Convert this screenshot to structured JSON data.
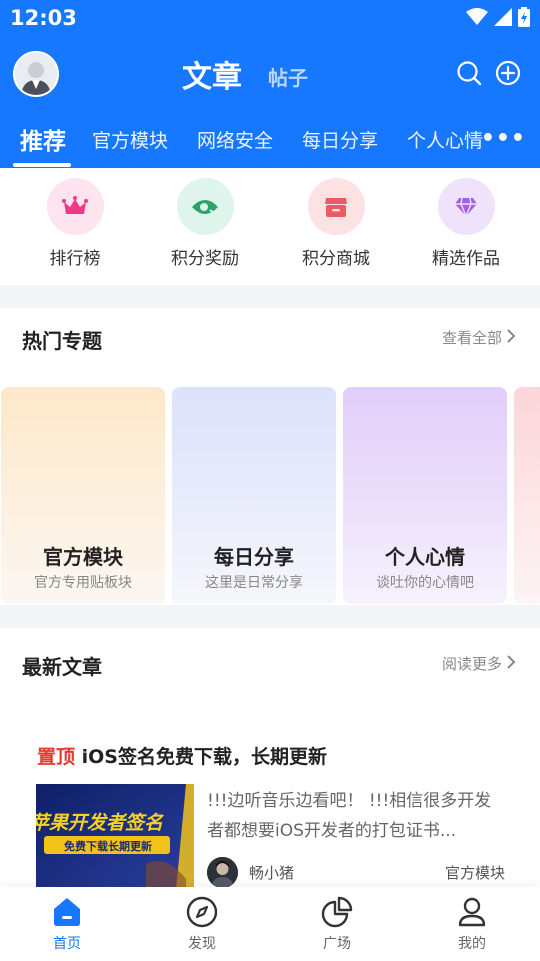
{
  "status_bar": {
    "time": "12:03"
  },
  "header": {
    "title": "文章",
    "subtitle": "帖子",
    "tabs": [
      {
        "label": "推荐",
        "active": true
      },
      {
        "label": "官方模块"
      },
      {
        "label": "网络安全"
      },
      {
        "label": "每日分享"
      },
      {
        "label": "个人心情"
      }
    ],
    "more": "•••"
  },
  "quick_actions": [
    {
      "label": "排行榜",
      "icon": "crown-icon",
      "bg": "#fde4ee",
      "color": "#ee3b87"
    },
    {
      "label": "积分奖励",
      "icon": "eye-icon",
      "bg": "#dff4ea",
      "color": "#29a36a"
    },
    {
      "label": "积分商城",
      "icon": "store-icon",
      "bg": "#fde2e4",
      "color": "#ea5b63"
    },
    {
      "label": "精选作品",
      "icon": "diamond-icon",
      "bg": "#efe3fb",
      "color": "#a35fe8"
    }
  ],
  "hot_topics": {
    "title": "热门专题",
    "more": "查看全部",
    "cards": [
      {
        "title": "官方模块",
        "subtitle": "官方专用贴板块",
        "color": "#fde8c8"
      },
      {
        "title": "每日分享",
        "subtitle": "这里是日常分享",
        "color": "#dfe3fb"
      },
      {
        "title": "个人心情",
        "subtitle": "谈吐你的心情吧",
        "color": "#e3d2fa"
      }
    ]
  },
  "latest": {
    "title": "最新文章",
    "more": "阅读更多",
    "posts": [
      {
        "pin": "置顶",
        "title": "iOS签名免费下载，长期更新",
        "thumb_text": "苹果开发者签名",
        "thumb_badge": "免费下载长期更新",
        "excerpt": "!!!边听音乐边看吧！ !!!相信很多开发者都想要iOS开发者的打包证书...",
        "author": "畅小猪",
        "category": "官方模块"
      }
    ]
  },
  "bottom_nav": [
    {
      "label": "首页",
      "icon": "home-icon",
      "active": true
    },
    {
      "label": "发现",
      "icon": "compass-icon"
    },
    {
      "label": "广场",
      "icon": "pie-chart-icon"
    },
    {
      "label": "我的",
      "icon": "user-icon"
    }
  ],
  "colors": {
    "primary": "#1677ff",
    "pin": "#e5392f"
  }
}
